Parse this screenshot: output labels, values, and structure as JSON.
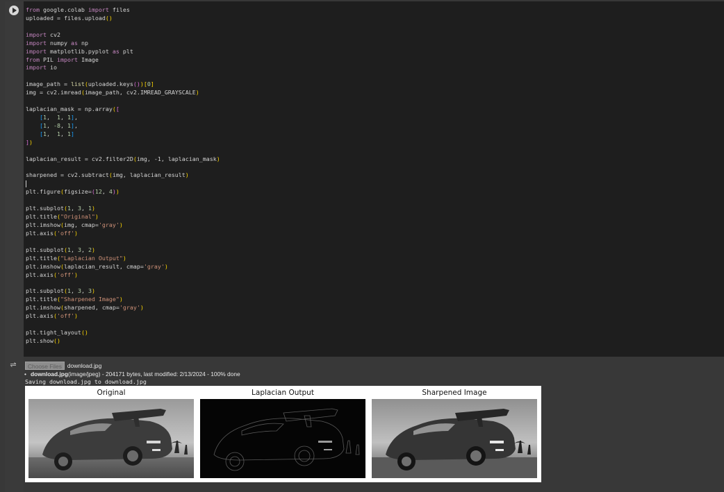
{
  "code_lines": [
    [
      [
        "kw",
        "from"
      ],
      [
        "t",
        " google.colab "
      ],
      [
        "kw",
        "import"
      ],
      [
        "t",
        " files"
      ]
    ],
    [
      [
        "t",
        "uploaded = files.upload"
      ],
      [
        "br1",
        "()"
      ]
    ],
    [],
    [
      [
        "kw",
        "import"
      ],
      [
        "t",
        " cv2"
      ]
    ],
    [
      [
        "kw",
        "import"
      ],
      [
        "t",
        " numpy "
      ],
      [
        "kw",
        "as"
      ],
      [
        "t",
        " np"
      ]
    ],
    [
      [
        "kw",
        "import"
      ],
      [
        "t",
        " matplotlib.pyplot "
      ],
      [
        "kw",
        "as"
      ],
      [
        "t",
        " plt"
      ]
    ],
    [
      [
        "kw",
        "from"
      ],
      [
        "t",
        " PIL "
      ],
      [
        "kw",
        "import"
      ],
      [
        "t",
        " Image"
      ]
    ],
    [
      [
        "kw",
        "import"
      ],
      [
        "t",
        " io"
      ]
    ],
    [],
    [
      [
        "t",
        "image_path = "
      ],
      [
        "fn",
        "list"
      ],
      [
        "br1",
        "("
      ],
      [
        "t",
        "uploaded.keys"
      ],
      [
        "br2",
        "()"
      ],
      [
        "br1",
        ")"
      ],
      [
        "br1",
        "["
      ],
      [
        "num",
        "0"
      ],
      [
        "br1",
        "]"
      ]
    ],
    [
      [
        "t",
        "img = cv2.imread"
      ],
      [
        "br1",
        "("
      ],
      [
        "t",
        "image_path, cv2.IMREAD_GRAYSCALE"
      ],
      [
        "br1",
        ")"
      ]
    ],
    [],
    [
      [
        "t",
        "laplacian_mask = np.array"
      ],
      [
        "br1",
        "("
      ],
      [
        "br2",
        "["
      ]
    ],
    [
      [
        "t",
        "    "
      ],
      [
        "br3",
        "["
      ],
      [
        "num",
        "1"
      ],
      [
        "t",
        ",  "
      ],
      [
        "num",
        "1"
      ],
      [
        "t",
        ", "
      ],
      [
        "num",
        "1"
      ],
      [
        "br3",
        "]"
      ],
      [
        "t",
        ","
      ]
    ],
    [
      [
        "t",
        "    "
      ],
      [
        "br3",
        "["
      ],
      [
        "num",
        "1"
      ],
      [
        "t",
        ", "
      ],
      [
        "num",
        "-8"
      ],
      [
        "t",
        ", "
      ],
      [
        "num",
        "1"
      ],
      [
        "br3",
        "]"
      ],
      [
        "t",
        ","
      ]
    ],
    [
      [
        "t",
        "    "
      ],
      [
        "br3",
        "["
      ],
      [
        "num",
        "1"
      ],
      [
        "t",
        ",  "
      ],
      [
        "num",
        "1"
      ],
      [
        "t",
        ", "
      ],
      [
        "num",
        "1"
      ],
      [
        "br3",
        "]"
      ]
    ],
    [
      [
        "br2",
        "]"
      ],
      [
        "br1",
        ")"
      ]
    ],
    [],
    [
      [
        "t",
        "laplacian_result = cv2.filter2D"
      ],
      [
        "br1",
        "("
      ],
      [
        "t",
        "img, -1, laplacian_mask"
      ],
      [
        "br1",
        ")"
      ]
    ],
    [],
    [
      [
        "t",
        "sharpened = cv2.subtract"
      ],
      [
        "br1",
        "("
      ],
      [
        "t",
        "img, laplacian_result"
      ],
      [
        "br1",
        ")"
      ]
    ],
    [
      [
        "cursor",
        ""
      ]
    ],
    [
      [
        "t",
        "plt.figure"
      ],
      [
        "br1",
        "("
      ],
      [
        "t",
        "figsize="
      ],
      [
        "br2",
        "("
      ],
      [
        "num",
        "12"
      ],
      [
        "t",
        ", "
      ],
      [
        "num",
        "4"
      ],
      [
        "br2",
        ")"
      ],
      [
        "br1",
        ")"
      ]
    ],
    [],
    [
      [
        "t",
        "plt.subplot"
      ],
      [
        "br1",
        "("
      ],
      [
        "num",
        "1"
      ],
      [
        "t",
        ", "
      ],
      [
        "num",
        "3"
      ],
      [
        "t",
        ", "
      ],
      [
        "num",
        "1"
      ],
      [
        "br1",
        ")"
      ]
    ],
    [
      [
        "t",
        "plt.title"
      ],
      [
        "br1",
        "("
      ],
      [
        "str",
        "\"Original\""
      ],
      [
        "br1",
        ")"
      ]
    ],
    [
      [
        "t",
        "plt.imshow"
      ],
      [
        "br1",
        "("
      ],
      [
        "t",
        "img, cmap="
      ],
      [
        "str",
        "'gray'"
      ],
      [
        "br1",
        ")"
      ]
    ],
    [
      [
        "t",
        "plt.axis"
      ],
      [
        "br1",
        "("
      ],
      [
        "str",
        "'off'"
      ],
      [
        "br1",
        ")"
      ]
    ],
    [],
    [
      [
        "t",
        "plt.subplot"
      ],
      [
        "br1",
        "("
      ],
      [
        "num",
        "1"
      ],
      [
        "t",
        ", "
      ],
      [
        "num",
        "3"
      ],
      [
        "t",
        ", "
      ],
      [
        "num",
        "2"
      ],
      [
        "br1",
        ")"
      ]
    ],
    [
      [
        "t",
        "plt.title"
      ],
      [
        "br1",
        "("
      ],
      [
        "str",
        "\"Laplacian Output\""
      ],
      [
        "br1",
        ")"
      ]
    ],
    [
      [
        "t",
        "plt.imshow"
      ],
      [
        "br1",
        "("
      ],
      [
        "t",
        "laplacian_result, cmap="
      ],
      [
        "str",
        "'gray'"
      ],
      [
        "br1",
        ")"
      ]
    ],
    [
      [
        "t",
        "plt.axis"
      ],
      [
        "br1",
        "("
      ],
      [
        "str",
        "'off'"
      ],
      [
        "br1",
        ")"
      ]
    ],
    [],
    [
      [
        "t",
        "plt.subplot"
      ],
      [
        "br1",
        "("
      ],
      [
        "num",
        "1"
      ],
      [
        "t",
        ", "
      ],
      [
        "num",
        "3"
      ],
      [
        "t",
        ", "
      ],
      [
        "num",
        "3"
      ],
      [
        "br1",
        ")"
      ]
    ],
    [
      [
        "t",
        "plt.title"
      ],
      [
        "br1",
        "("
      ],
      [
        "str",
        "\"Sharpened Image\""
      ],
      [
        "br1",
        ")"
      ]
    ],
    [
      [
        "t",
        "plt.imshow"
      ],
      [
        "br1",
        "("
      ],
      [
        "t",
        "sharpened, cmap="
      ],
      [
        "str",
        "'gray'"
      ],
      [
        "br1",
        ")"
      ]
    ],
    [
      [
        "t",
        "plt.axis"
      ],
      [
        "br1",
        "("
      ],
      [
        "str",
        "'off'"
      ],
      [
        "br1",
        ")"
      ]
    ],
    [],
    [
      [
        "t",
        "plt.tight_layout"
      ],
      [
        "br1",
        "()"
      ]
    ],
    [
      [
        "t",
        "plt.show"
      ],
      [
        "br1",
        "()"
      ]
    ]
  ],
  "output": {
    "choose_files_label": "Choose Files",
    "chosen_file": "download.jpg",
    "file_name": "download.jpg",
    "file_details": "(image/jpeg) - 204171 bytes, last modified: 2/13/2024 - 100% done",
    "bullet": "•",
    "saving_text": "Saving download.jpg to download.jpg",
    "panels": [
      {
        "title": "Original"
      },
      {
        "title": "Laplacian Output"
      },
      {
        "title": "Sharpened Image"
      }
    ]
  },
  "icons": {
    "run": "play-circle-icon",
    "output": "output-toggle-icon"
  },
  "colors": {
    "editor_bg": "#1e1e1e",
    "keyword": "#c586c0",
    "string": "#ce9178",
    "number": "#b5cea8",
    "bracket_1": "#ffd700",
    "bracket_2": "#da70d6",
    "bracket_3": "#179fff"
  }
}
